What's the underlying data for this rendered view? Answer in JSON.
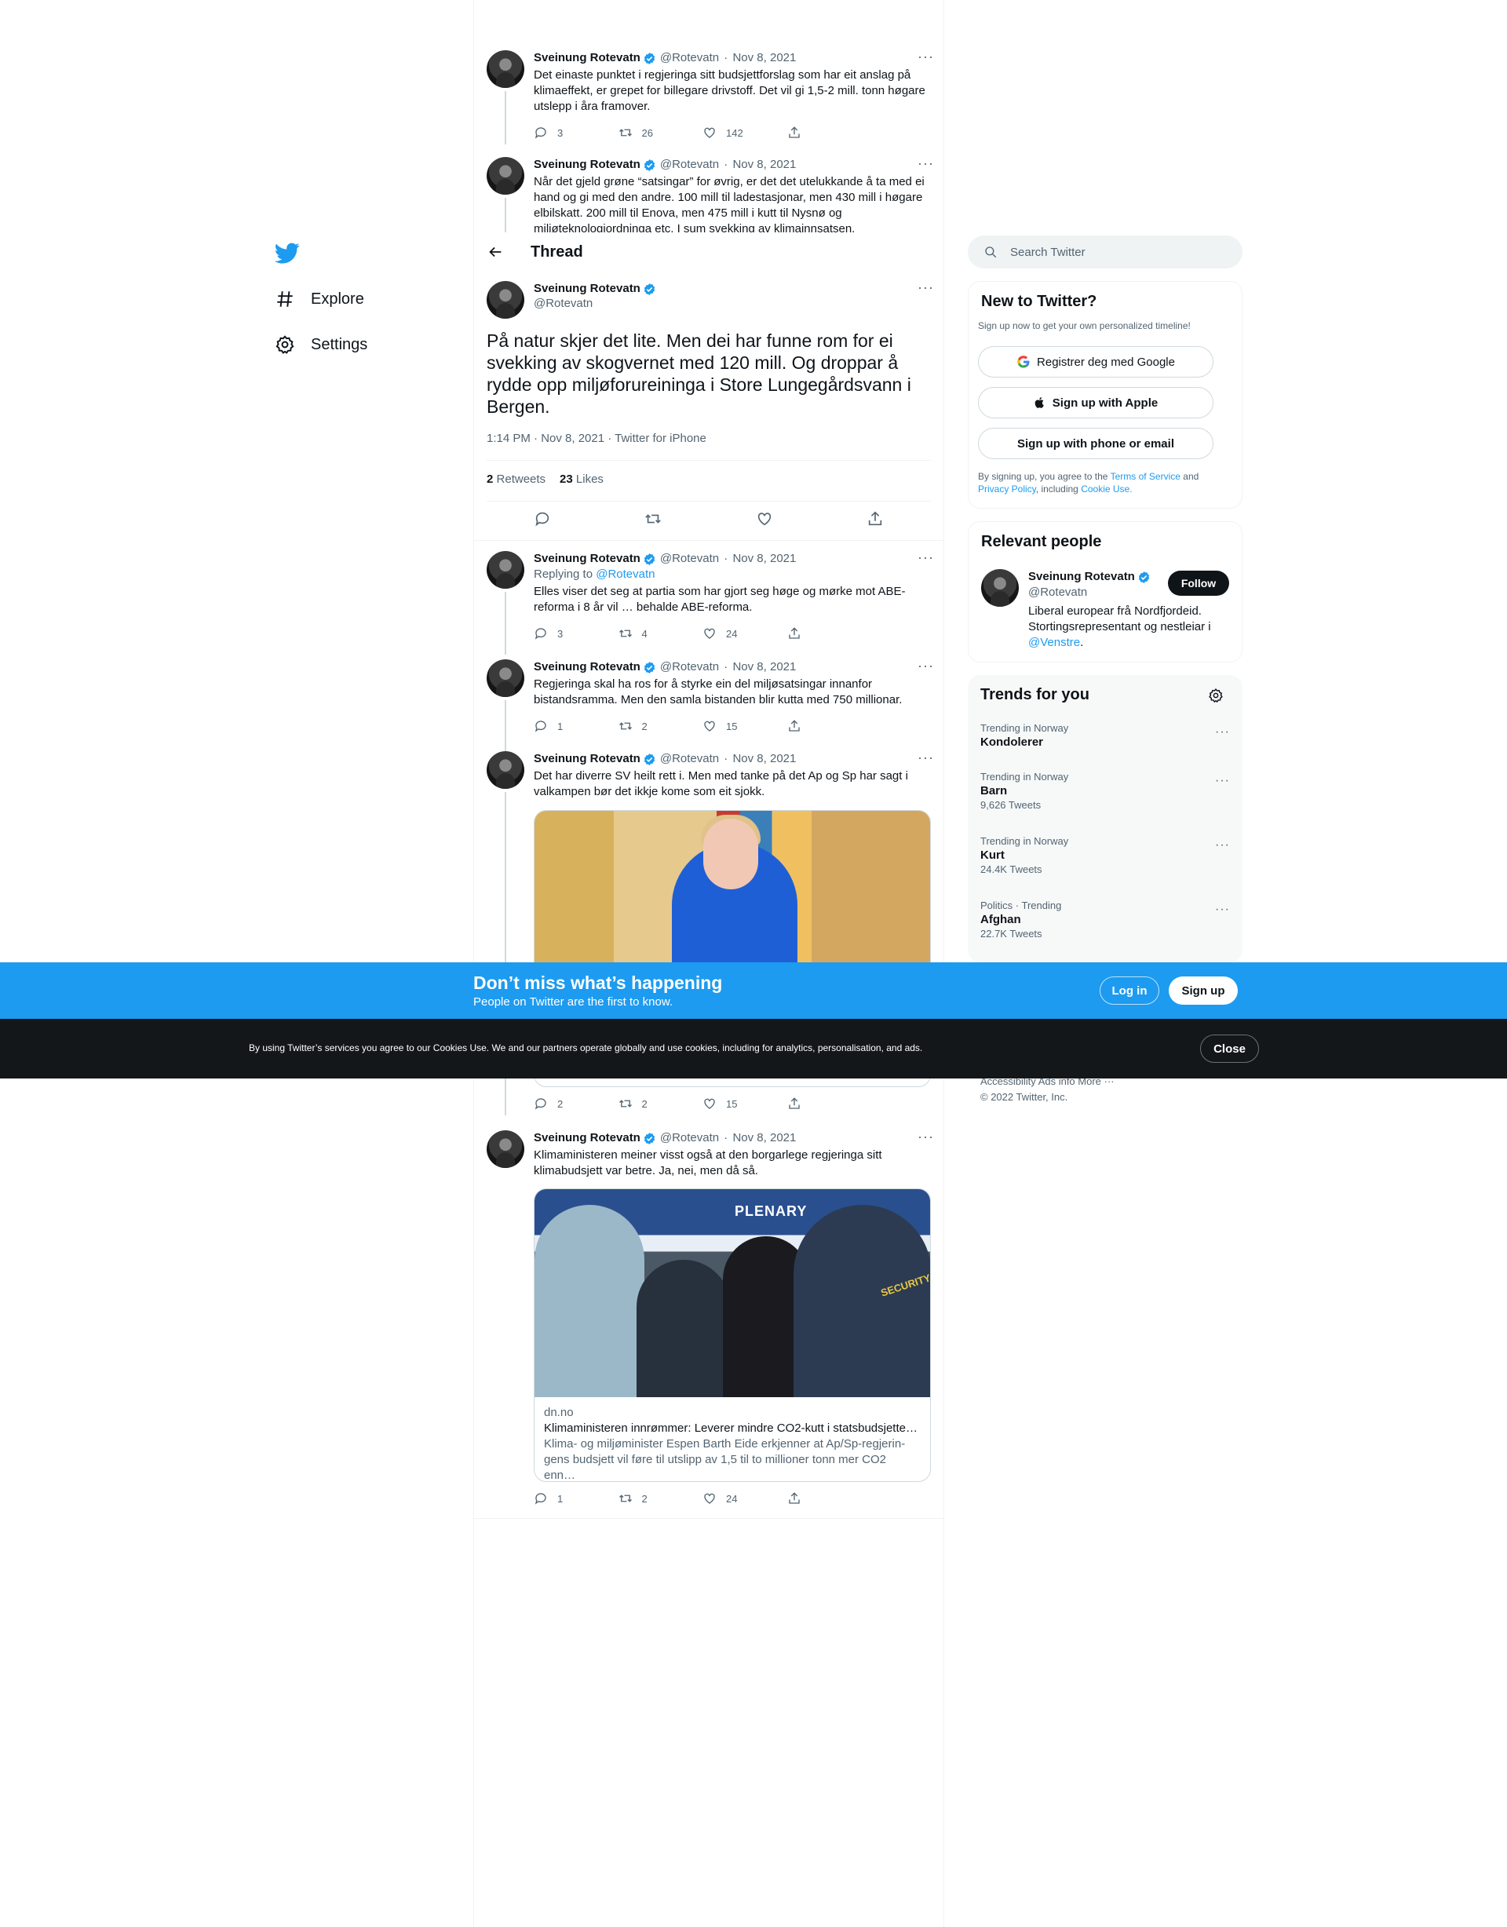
{
  "nav": {
    "explore": "Explore",
    "settings": "Settings"
  },
  "header": {
    "title": "Thread"
  },
  "author": {
    "name": "Sveinung Rotevatn",
    "handle": "@Rotevatn"
  },
  "above_tweets": [
    {
      "date": "Nov 8, 2021",
      "text": "Det einaste punktet i regjeringa sitt budsjettforslag som har eit anslag på klimaeffekt, er grepet for billegare drivstoff. Det vil gi 1,5-2 mill. tonn høgare utslepp i åra framover.",
      "replies": "3",
      "retweets": "26",
      "likes": "142"
    },
    {
      "date": "Nov 8, 2021",
      "text": "Når det gjeld grøne “satsingar” for øvrig, er det det utelukkande å ta med ei hand og gi med den andre. 100 mill til ladestasjonar, men 430 mill i høgare elbilskatt. 200 mill til Enova, men 475 mill i kutt til Nysnø og miljøteknologiordninga etc. I sum svekking av klimainnsatsen."
    }
  ],
  "main_tweet": {
    "text": "På natur skjer det lite. Men dei har funne rom for ei svekking av skogvernet med 120 mill. Og droppar å rydde opp miljøforureininga i Store Lungegårdsvann i Bergen.",
    "meta": "1:14 PM · Nov 8, 2021 · Twitter for iPhone",
    "retweets_count": "2",
    "retweets_label": "Retweets",
    "likes_count": "23",
    "likes_label": "Likes"
  },
  "replies": [
    {
      "date": "Nov 8, 2021",
      "replying_to": "Replying to",
      "replying_handle": "@Rotevatn",
      "text": "Elles viser det seg at partia som har gjort seg høge og mørke mot ABE-reforma i 8 år vil … behalde ABE-reforma.",
      "replies": "3",
      "retweets": "4",
      "likes": "24"
    },
    {
      "date": "Nov 8, 2021",
      "text": "Regjeringa skal ha ros for å styrke ein del miljøsatsingar innanfor bistandsramma. Men den samla bistanden blir kutta med 750 millionar.",
      "replies": "1",
      "retweets": "2",
      "likes": "15"
    },
    {
      "date": "Nov 8, 2021",
      "text": "Det har diverre SV heilt rett i. Men med tanke på det Ap og Sp har sagt i valkampen bør det ikkje kome som eit sjokk.",
      "replies": "2",
      "retweets": "2",
      "likes": "15"
    },
    {
      "date": "Nov 8, 2021",
      "text": "Klimaministeren meiner visst også at den borgarlege regjeringa sitt klimabudsjett var betre. Ja, nei, men då så.",
      "card_domain": "dn.no",
      "card_title": "Klimaministeren innrømmer: Leverer mindre CO2-kutt i statsbudsjettet…",
      "card_desc": "Klima- og miljøminister Espen Barth Eide erkjenner at Ap/Sp-regjerin­gens budsjett vil føre til utslipp av 1,5 til to millioner tonn mer CO2 enn…",
      "photo_banner": "PLENARY",
      "photo_badge": "SECURITY",
      "replies": "1",
      "retweets": "2",
      "likes": "24"
    }
  ],
  "search": {
    "placeholder": "Search Twitter"
  },
  "new_to_twitter": {
    "title": "New to Twitter?",
    "subtitle": "Sign up now to get your own personalized timeline!",
    "google": "Registrer deg med Google",
    "apple": "Sign up with Apple",
    "phone": "Sign up with phone or email",
    "legal_1": "By signing up, you agree to the",
    "terms": "Terms of Service",
    "legal_2": "and",
    "privacy": "Privacy Policy",
    "legal_3": ", including",
    "cookie": "Cookie Use."
  },
  "relevant": {
    "title": "Relevant people",
    "follow": "Follow",
    "bio_1": "Liberal europear frå Nordfjordeid. Stortingsrepresentant og nestleiar i",
    "bio_link": "@Venstre",
    "bio_end": "."
  },
  "trends": {
    "title": "Trends for you",
    "items": [
      {
        "context": "Trending in Norway",
        "name": "Kondolerer",
        "count": ""
      },
      {
        "context": "Trending in Norway",
        "name": "Barn",
        "count": "9,626 Tweets"
      },
      {
        "context": "Trending in Norway",
        "name": "Kurt",
        "count": "24.4K Tweets"
      },
      {
        "context": "Politics · Trending",
        "name": "Afghan",
        "count": "22.7K Tweets"
      }
    ]
  },
  "footer": {
    "links": "Accessibility   Ads info   More ···",
    "copyright": "© 2022 Twitter, Inc."
  },
  "banner": {
    "headline": "Don’t miss what’s happening",
    "sub": "People on Twitter are the first to know.",
    "login": "Log in",
    "signup": "Sign up"
  },
  "cookie_bar": {
    "text": "By using Twitter’s services you agree to our Cookies Use. We and our partners operate globally and use cookies, including for analytics, personalisation, and ads.",
    "close": "Close"
  },
  "colors": {
    "accent": "#1d9bf0",
    "text": "#0f1419",
    "muted": "#536471",
    "cookie_bg": "#14171a"
  }
}
